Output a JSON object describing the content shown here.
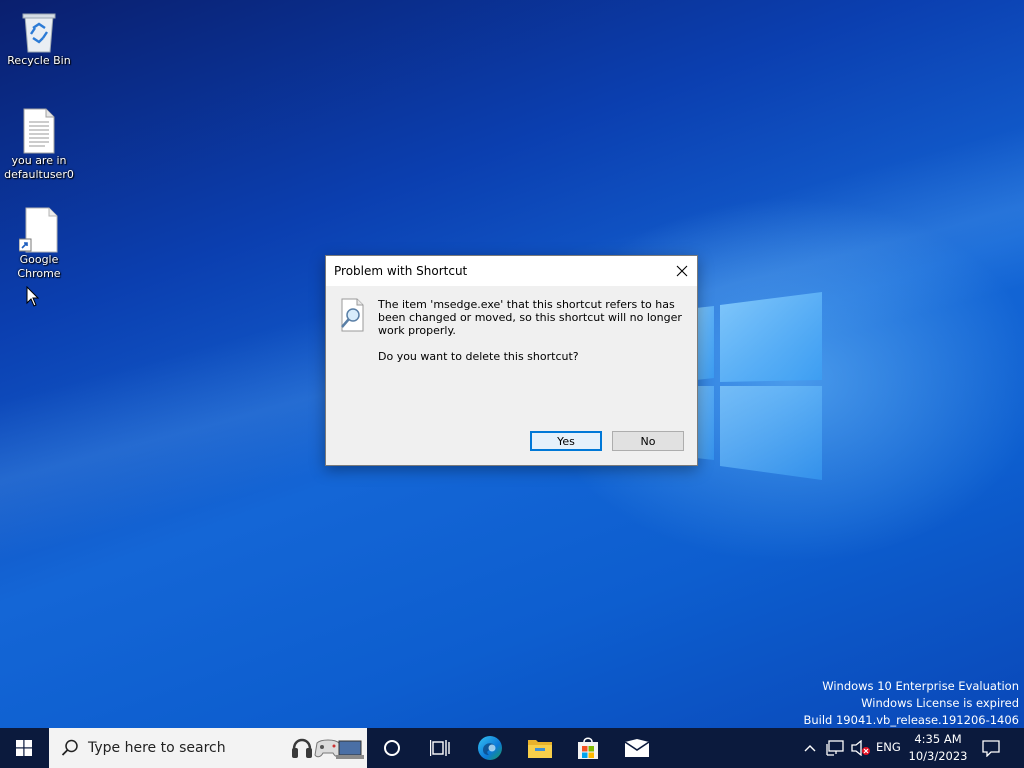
{
  "desktop": {
    "icons": [
      {
        "label": "Recycle Bin"
      },
      {
        "label_line1": "you are in",
        "label_line2": "defaultuser0"
      },
      {
        "label_line1": "Google",
        "label_line2": "Chrome"
      }
    ],
    "watermark": {
      "line1": "Windows 10 Enterprise Evaluation",
      "line2": "Windows License is expired",
      "line3": "Build 19041.vb_release.191206-1406"
    }
  },
  "dialog": {
    "title": "Problem with Shortcut",
    "message": "The item 'msedge.exe' that this shortcut refers to has been changed or moved, so this shortcut will no longer work properly.",
    "question": "Do you want to delete this shortcut?",
    "yes_label": "Yes",
    "no_label": "No"
  },
  "taskbar": {
    "search_placeholder": "Type here to search",
    "language": "ENG",
    "time": "4:35 AM",
    "date": "10/3/2023",
    "accent_color": "#0078d7"
  }
}
